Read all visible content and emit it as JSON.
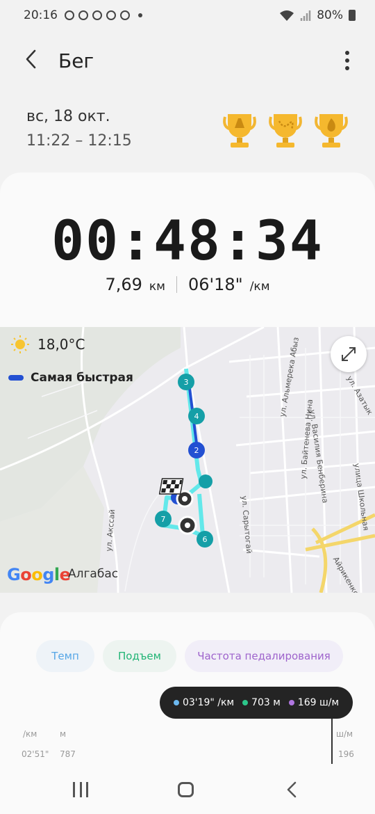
{
  "status_bar": {
    "time": "20:16",
    "battery": "80%"
  },
  "header": {
    "title": "Бег",
    "back_icon": "back-arrow-icon",
    "menu_icon": "more-vert-icon"
  },
  "workout": {
    "date": "вс, 18 окт.",
    "time_range": "11:22 – 12:15",
    "trophies": [
      "trophy-distance-icon",
      "trophy-route-icon",
      "trophy-calories-icon"
    ],
    "duration": "00:48:34",
    "distance_value": "7,69",
    "distance_unit": "км",
    "pace_value": "06'18\"",
    "pace_unit": "/км"
  },
  "map": {
    "temperature": "18,0°C",
    "legend": "Самая быстрая",
    "city": "Алгабас",
    "google": "Google",
    "markers": [
      "3",
      "4",
      "2",
      "7",
      "6"
    ],
    "streets": [
      "ул. Альмерека Абыз",
      "ул. Василия Бенберина",
      "ул. Байтенева Нина",
      "ул. Сарытогай",
      "ул. Акссай",
      "ул. Азатык",
      "улица Школьная",
      "Айрикенкс"
    ]
  },
  "chart": {
    "tabs": [
      "Темп",
      "Подъем",
      "Частота педалирования"
    ],
    "tooltip": {
      "pace": "03'19\" /км",
      "elevation": "703 м",
      "cadence": "169 ш/м"
    },
    "left_axis_unit": "/км",
    "elev_axis_unit": "м",
    "right_axis_unit": "ш/м",
    "left_axis_top": "02'51\"",
    "elev_axis_top": "787",
    "right_axis_top": "196",
    "colors": {
      "pace": "#6cb9f0",
      "elevation": "#2cc68a",
      "cadence": "#b076e0"
    }
  },
  "navbar": {
    "recent": "recent-apps-icon",
    "home": "home-icon",
    "back": "nav-back-icon"
  }
}
